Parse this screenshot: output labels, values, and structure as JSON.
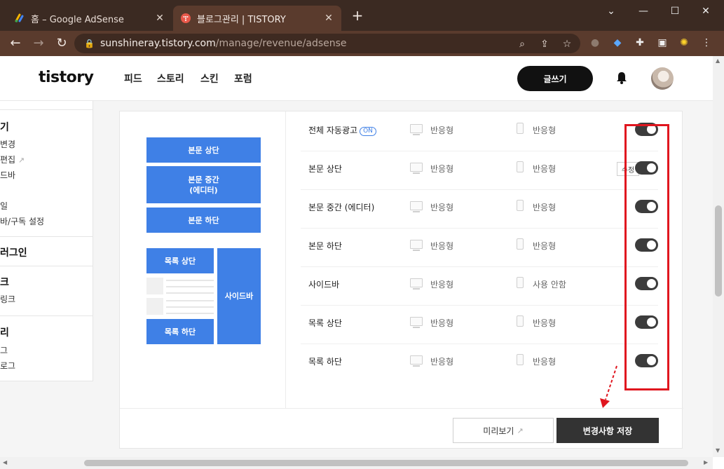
{
  "browser": {
    "tabs": [
      {
        "title": "홈 – Google AdSense",
        "close": "✕"
      },
      {
        "title": "블로그관리 | TISTORY",
        "close": "✕"
      }
    ],
    "new_tab": "+",
    "window": {
      "minimize": "⌄",
      "restore": "—",
      "maximize": "☐",
      "close": "✕"
    },
    "address": {
      "host": "sunshineray.tistory.com",
      "path": "/manage/revenue/adsense"
    }
  },
  "header": {
    "logo": "tistory",
    "nav": [
      "피드",
      "스토리",
      "스킨",
      "포럼"
    ],
    "write_label": "글쓰기"
  },
  "sidebar": {
    "groups": [
      {
        "title": "기",
        "items": [
          "변경",
          "편집",
          "드바",
          "",
          "일",
          "바/구독 설정"
        ]
      },
      {
        "title": "러그인",
        "items": []
      },
      {
        "title": "크",
        "items": [
          "링크"
        ]
      },
      {
        "title": "리",
        "items": [
          "그",
          "로그"
        ]
      }
    ]
  },
  "diagram": {
    "top": "본문 상단",
    "middle_line1": "본문 중간",
    "middle_line2": "(에디터)",
    "bottom": "본문 하단",
    "list_top": "목록 상단",
    "list_bottom": "목록 하단",
    "sidebar": "사이드바"
  },
  "ad_rows": [
    {
      "label": "전체 자동광고",
      "badge": "ON",
      "pc": "반응형",
      "mobile": "반응형",
      "edit": ""
    },
    {
      "label": "본문 상단",
      "badge": "",
      "pc": "반응형",
      "mobile": "반응형",
      "edit": "수정"
    },
    {
      "label": "본문 중간 (에디터)",
      "badge": "",
      "pc": "반응형",
      "mobile": "반응형",
      "edit": ""
    },
    {
      "label": "본문 하단",
      "badge": "",
      "pc": "반응형",
      "mobile": "반응형",
      "edit": ""
    },
    {
      "label": "사이드바",
      "badge": "",
      "pc": "반응형",
      "mobile": "사용 안함",
      "edit": ""
    },
    {
      "label": "목록 상단",
      "badge": "",
      "pc": "반응형",
      "mobile": "반응형",
      "edit": ""
    },
    {
      "label": "목록 하단",
      "badge": "",
      "pc": "반응형",
      "mobile": "반응형",
      "edit": ""
    }
  ],
  "footer": {
    "preview_label": "미리보기",
    "save_label": "변경사항 저장"
  },
  "colors": {
    "accent": "#3f80e6",
    "toggle_on": "#3c3c3c",
    "annotation": "#e0161f",
    "chrome": "#5a3b2d"
  }
}
